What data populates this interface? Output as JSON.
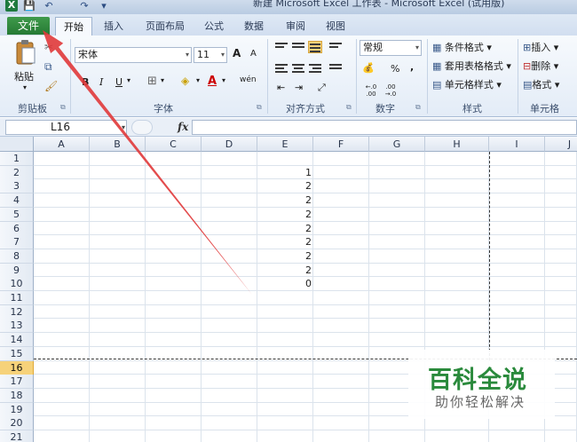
{
  "window": {
    "title": "新建 Microsoft Excel 工作表 - Microsoft Excel (试用版)"
  },
  "quick_access": {
    "app_icon": "X",
    "save": "💾",
    "undo": "↶",
    "redo": "↷",
    "customize": "▾"
  },
  "tabs": [
    {
      "label": "文件"
    },
    {
      "label": "开始"
    },
    {
      "label": "插入"
    },
    {
      "label": "页面布局"
    },
    {
      "label": "公式"
    },
    {
      "label": "数据"
    },
    {
      "label": "审阅"
    },
    {
      "label": "视图"
    }
  ],
  "ribbon": {
    "clipboard": {
      "label": "剪贴板",
      "paste": "粘贴"
    },
    "font": {
      "label": "字体",
      "name": "宋体",
      "size": "11",
      "grow": "A",
      "shrink": "A",
      "bold": "B",
      "italic": "I",
      "underline": "U",
      "color_letter": "A",
      "wen": "wén"
    },
    "alignment": {
      "label": "对齐方式"
    },
    "number": {
      "label": "数字",
      "format": "常规",
      "percent": "%",
      "comma": ",",
      "inc_decimal": "←.0 .00",
      "dec_decimal": ".00 →.0"
    },
    "styles": {
      "label": "样式",
      "conditional": "条件格式 ▾",
      "as_table": "套用表格格式 ▾",
      "cell_styles": "单元格样式 ▾"
    },
    "cells": {
      "label": "单元格",
      "insert": "插入 ▾",
      "delete": "删除 ▾",
      "format": "格式 ▾"
    }
  },
  "formula_bar": {
    "name_box": "L16",
    "fx": "fx",
    "value": ""
  },
  "sheet": {
    "columns": [
      "A",
      "B",
      "C",
      "D",
      "E",
      "F",
      "G",
      "H",
      "I",
      "J"
    ],
    "rows": [
      "1",
      "2",
      "3",
      "4",
      "5",
      "6",
      "7",
      "8",
      "9",
      "10",
      "11",
      "12",
      "13",
      "14",
      "15",
      "16",
      "17",
      "18",
      "19",
      "20",
      "21"
    ],
    "active_row": "16",
    "col_e_values": [
      "",
      "1",
      "2",
      "2",
      "2",
      "2",
      "2",
      "2",
      "2",
      "0"
    ]
  },
  "watermark": {
    "title": "百科全说",
    "subtitle": "助你轻松解决"
  },
  "colors": {
    "file_tab": "#2f8a3d",
    "annotation_arrow": "#e0383a",
    "active_row_header": "#f6d27a"
  }
}
